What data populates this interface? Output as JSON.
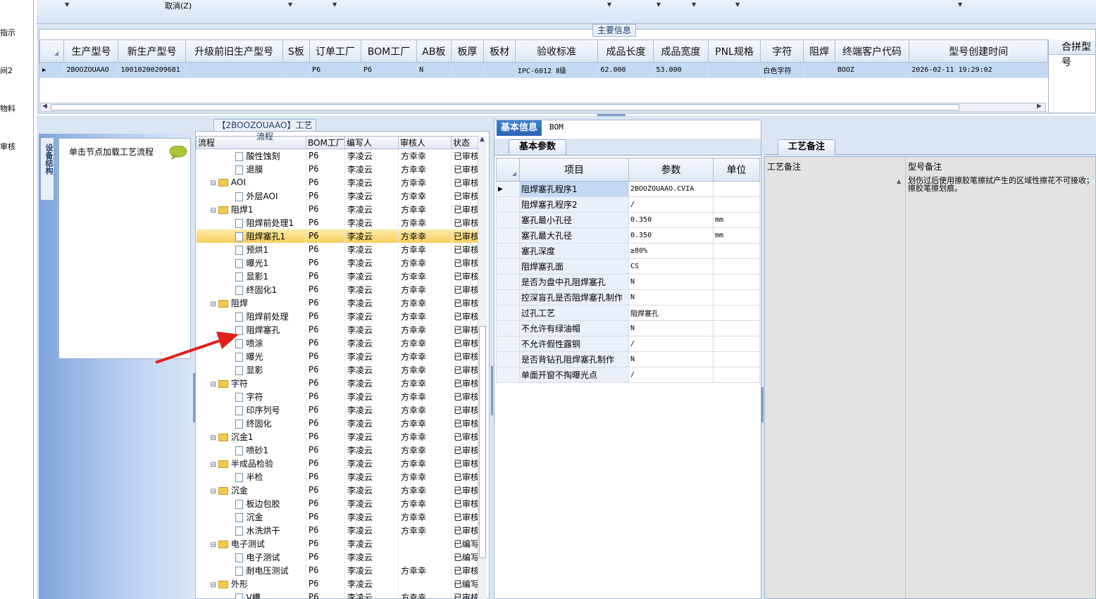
{
  "left_strip": {
    "items": [
      "指示",
      "间2",
      "物料",
      "审核"
    ]
  },
  "toolbar": {
    "cancel_label": "取消(Z)"
  },
  "main_info": {
    "legend": "主要信息",
    "columns": [
      "生产型号",
      "新生产型号",
      "升级前旧生产型号",
      "S板",
      "订单工厂",
      "BOM工厂",
      "AB板",
      "板厚",
      "板材",
      "验收标准",
      "成品长度",
      "成品宽度",
      "PNL规格",
      "字符",
      "阻焊",
      "终端客户代码",
      "型号创建时间"
    ],
    "row": [
      "2BOOZOUAAO",
      "10010200209681",
      "",
      "",
      "P6",
      "P6",
      "N",
      "",
      "",
      "IPC-6012 Ⅱ级",
      "62.000",
      "53.000",
      "",
      "白色字符",
      "",
      "BOOZ",
      "2026-02-11 19:29:02"
    ],
    "panel_title": "合拼型号"
  },
  "equipment": {
    "tab_label": "设备结构",
    "hint": "单击节点加载工艺流程"
  },
  "flow": {
    "legend": "【2BOOZOUAAO】工艺流程",
    "columns": [
      "流程",
      "BOM工厂",
      "编写人",
      "审核人",
      "状态"
    ],
    "rows": [
      {
        "type": "doc",
        "name": "酸性蚀刻",
        "bom": "P6",
        "writer": "李凌云",
        "auditor": "方幸幸",
        "status": "已审核"
      },
      {
        "type": "doc",
        "name": "退膜",
        "bom": "P6",
        "writer": "李凌云",
        "auditor": "方幸幸",
        "status": "已审核"
      },
      {
        "type": "folder",
        "name": "AOI",
        "bom": "P6",
        "writer": "李凌云",
        "auditor": "方幸幸",
        "status": "已审核"
      },
      {
        "type": "doc",
        "name": "外层AOI",
        "bom": "P6",
        "writer": "李凌云",
        "auditor": "方幸幸",
        "status": "已审核"
      },
      {
        "type": "folder",
        "name": "阻焊1",
        "bom": "P6",
        "writer": "李凌云",
        "auditor": "方幸幸",
        "status": "已审核"
      },
      {
        "type": "doc",
        "name": "阻焊前处理1",
        "bom": "P6",
        "writer": "李凌云",
        "auditor": "方幸幸",
        "status": "已审核"
      },
      {
        "type": "doc",
        "name": "阻焊塞孔1",
        "bom": "P6",
        "writer": "李凌云",
        "auditor": "方幸幸",
        "status": "已审核",
        "selected": true
      },
      {
        "type": "doc",
        "name": "预烘1",
        "bom": "P6",
        "writer": "李凌云",
        "auditor": "方幸幸",
        "status": "已审核"
      },
      {
        "type": "doc",
        "name": "曝光1",
        "bom": "P6",
        "writer": "李凌云",
        "auditor": "方幸幸",
        "status": "已审核"
      },
      {
        "type": "doc",
        "name": "显影1",
        "bom": "P6",
        "writer": "李凌云",
        "auditor": "方幸幸",
        "status": "已审核"
      },
      {
        "type": "doc",
        "name": "终固化1",
        "bom": "P6",
        "writer": "李凌云",
        "auditor": "方幸幸",
        "status": "已审核"
      },
      {
        "type": "folder",
        "name": "阻焊",
        "bom": "P6",
        "writer": "李凌云",
        "auditor": "方幸幸",
        "status": "已审核"
      },
      {
        "type": "doc",
        "name": "阻焊前处理",
        "bom": "P6",
        "writer": "李凌云",
        "auditor": "方幸幸",
        "status": "已审核"
      },
      {
        "type": "doc",
        "name": "阻焊塞孔",
        "bom": "P6",
        "writer": "李凌云",
        "auditor": "方幸幸",
        "status": "已审核"
      },
      {
        "type": "doc",
        "name": "喷涂",
        "bom": "P6",
        "writer": "李凌云",
        "auditor": "方幸幸",
        "status": "已审核"
      },
      {
        "type": "doc",
        "name": "曝光",
        "bom": "P6",
        "writer": "李凌云",
        "auditor": "方幸幸",
        "status": "已审核"
      },
      {
        "type": "doc",
        "name": "显影",
        "bom": "P6",
        "writer": "李凌云",
        "auditor": "方幸幸",
        "status": "已审核"
      },
      {
        "type": "folder",
        "name": "字符",
        "bom": "P6",
        "writer": "李凌云",
        "auditor": "方幸幸",
        "status": "已审核"
      },
      {
        "type": "doc",
        "name": "字符",
        "bom": "P6",
        "writer": "李凌云",
        "auditor": "方幸幸",
        "status": "已审核"
      },
      {
        "type": "doc",
        "name": "印序列号",
        "bom": "P6",
        "writer": "李凌云",
        "auditor": "方幸幸",
        "status": "已审核"
      },
      {
        "type": "doc",
        "name": "终固化",
        "bom": "P6",
        "writer": "李凌云",
        "auditor": "方幸幸",
        "status": "已审核"
      },
      {
        "type": "folder",
        "name": "沉金1",
        "bom": "P6",
        "writer": "李凌云",
        "auditor": "方幸幸",
        "status": "已审核"
      },
      {
        "type": "doc",
        "name": "喷砂1",
        "bom": "P6",
        "writer": "李凌云",
        "auditor": "方幸幸",
        "status": "已审核"
      },
      {
        "type": "folder",
        "name": "半成品检验",
        "bom": "P6",
        "writer": "李凌云",
        "auditor": "方幸幸",
        "status": "已审核"
      },
      {
        "type": "doc",
        "name": "半检",
        "bom": "P6",
        "writer": "李凌云",
        "auditor": "方幸幸",
        "status": "已审核"
      },
      {
        "type": "folder",
        "name": "沉金",
        "bom": "P6",
        "writer": "李凌云",
        "auditor": "方幸幸",
        "status": "已审核"
      },
      {
        "type": "doc",
        "name": "板边包胶",
        "bom": "P6",
        "writer": "李凌云",
        "auditor": "方幸幸",
        "status": "已审核"
      },
      {
        "type": "doc",
        "name": "沉金",
        "bom": "P6",
        "writer": "李凌云",
        "auditor": "方幸幸",
        "status": "已审核"
      },
      {
        "type": "doc",
        "name": "水洗烘干",
        "bom": "P6",
        "writer": "李凌云",
        "auditor": "方幸幸",
        "status": "已审核"
      },
      {
        "type": "folder",
        "name": "电子测试",
        "bom": "P6",
        "writer": "李凌云",
        "auditor": "",
        "status": "已编写"
      },
      {
        "type": "doc",
        "name": "电子测试",
        "bom": "P6",
        "writer": "李凌云",
        "auditor": "",
        "status": "已编写"
      },
      {
        "type": "doc",
        "name": "耐电压测试",
        "bom": "P6",
        "writer": "李凌云",
        "auditor": "方幸幸",
        "status": "已审核"
      },
      {
        "type": "folder",
        "name": "外形",
        "bom": "P6",
        "writer": "李凌云",
        "auditor": "",
        "status": "已编写"
      },
      {
        "type": "doc",
        "name": "V槽",
        "bom": "P6",
        "writer": "李凌云",
        "auditor": "方幸幸",
        "status": "已审核"
      }
    ]
  },
  "basic": {
    "tabs": [
      "基本信息",
      "BOM"
    ],
    "subtab": "基本参数",
    "columns": [
      "项目",
      "参数",
      "单位"
    ],
    "rows": [
      {
        "item": "阻焊塞孔程序1",
        "param": "2BOOZOUAAO.CVIA",
        "unit": ""
      },
      {
        "item": "阻焊塞孔程序2",
        "param": "/",
        "unit": ""
      },
      {
        "item": "塞孔最小孔径",
        "param": "0.350",
        "unit": "mm"
      },
      {
        "item": "塞孔最大孔径",
        "param": "0.350",
        "unit": "mm"
      },
      {
        "item": "塞孔深度",
        "param": "≥80%",
        "unit": ""
      },
      {
        "item": "阻焊塞孔面",
        "param": "CS",
        "unit": ""
      },
      {
        "item": "是否为盘中孔阻焊塞孔",
        "param": "N",
        "unit": ""
      },
      {
        "item": "控深盲孔是否阻焊塞孔制作",
        "param": "N",
        "unit": ""
      },
      {
        "item": "过孔工艺",
        "param": "阻焊塞孔",
        "unit": ""
      },
      {
        "item": "不允许有绿油帽",
        "param": "N",
        "unit": ""
      },
      {
        "item": "不允许假性露铜",
        "param": "/",
        "unit": ""
      },
      {
        "item": "是否背钻孔阻焊塞孔制作",
        "param": "N",
        "unit": ""
      },
      {
        "item": "单面开窗不掏曝光点",
        "param": "/",
        "unit": ""
      }
    ]
  },
  "process": {
    "subtab": "工艺备注",
    "col1": "工艺备注",
    "col2": "型号备注",
    "note": "划伤过后使用擦胶笔擦拭产生的区域性擦花不可接收；擦胶笔擦划痕。"
  }
}
